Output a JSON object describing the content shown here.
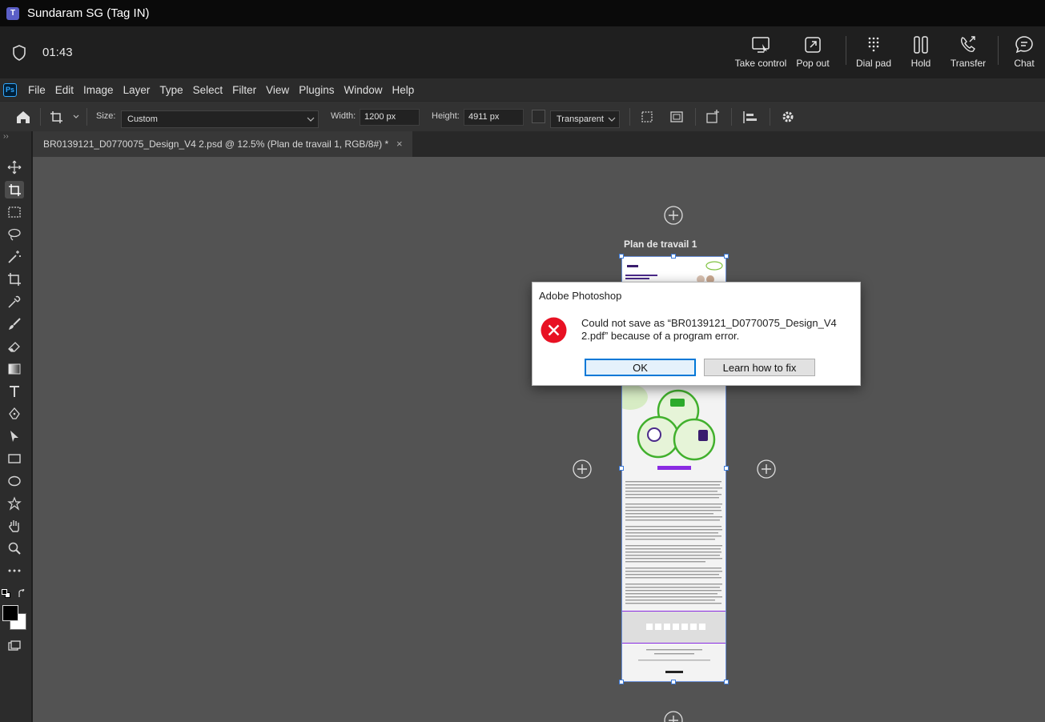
{
  "teams": {
    "title": "Sundaram SG (Tag IN)",
    "call_time": "01:43",
    "buttons": {
      "take_control": "Take control",
      "pop_out": "Pop out",
      "dial_pad": "Dial pad",
      "hold": "Hold",
      "transfer": "Transfer",
      "chat": "Chat"
    }
  },
  "photoshop": {
    "menu": [
      "File",
      "Edit",
      "Image",
      "Layer",
      "Type",
      "Select",
      "Filter",
      "View",
      "Plugins",
      "Window",
      "Help"
    ],
    "options": {
      "size_label": "Size:",
      "size_value": "Custom",
      "width_label": "Width:",
      "width_value": "1200 px",
      "height_label": "Height:",
      "height_value": "4911 px",
      "background_value": "Transparent"
    },
    "tab": {
      "title": "BR0139121_D0770075_Design_V4 2.psd @ 12.5% (Plan de travail 1, RGB/8#) *",
      "close": "×"
    },
    "canvas": {
      "artboard_label": "Plan de travail 1"
    }
  },
  "dialog": {
    "title": "Adobe Photoshop",
    "message": "Could not save as “BR0139121_D0770075_Design_V4 2.pdf” because of a program error.",
    "ok_label": "OK",
    "learn_label": "Learn how to fix"
  },
  "colors": {
    "teams_bg": "#1f1f1f",
    "ps_canvas": "#535353",
    "error_red": "#e81123",
    "dialog_focus": "#0078d7"
  }
}
